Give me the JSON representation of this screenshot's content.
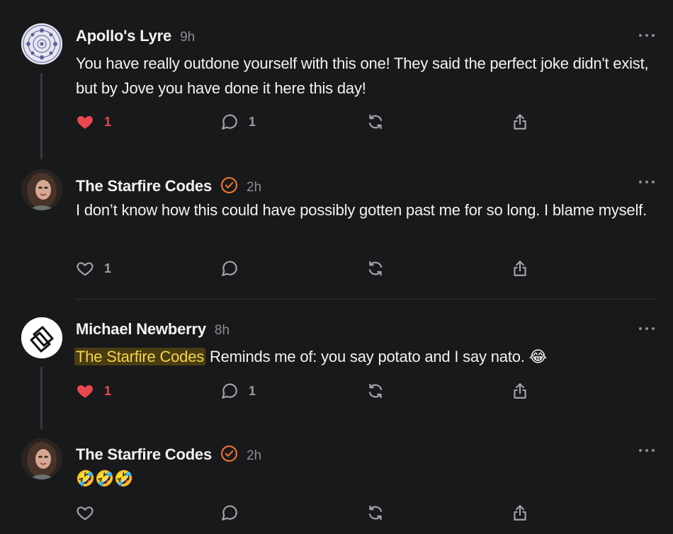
{
  "posts": [
    {
      "author": "Apollo's Lyre",
      "time": "9h",
      "text": "You have really outdone yourself with this one! They said the perfect joke didn't exist, but by Jove you have done it here this day!",
      "likes": "1",
      "replies": "1",
      "liked": true,
      "verified": false
    },
    {
      "author": "The Starfire Codes",
      "time": "2h",
      "text": "I don’t know how this could have possibly gotten past me for so long. I blame myself.",
      "likes": "1",
      "replies": "",
      "liked": false,
      "verified": true
    },
    {
      "author": "Michael Newberry",
      "time": "8h",
      "mention": "The Starfire Codes",
      "text": " Reminds me of: you say potato and I say nato. 😂",
      "likes": "1",
      "replies": "1",
      "liked": true,
      "verified": false
    },
    {
      "author": "The Starfire Codes",
      "time": "2h",
      "text": "🤣🤣🤣",
      "likes": "",
      "replies": "",
      "liked": false,
      "verified": true
    }
  ],
  "colors": {
    "background": "#18191b",
    "like_active": "#e8484e",
    "verified": "#f0762e",
    "mention_bg": "#4a3d12",
    "mention_text": "#f5d34a"
  },
  "icons": [
    "heart-icon",
    "comment-icon",
    "repost-icon",
    "share-icon",
    "more-options-icon",
    "verified-badge-icon"
  ]
}
